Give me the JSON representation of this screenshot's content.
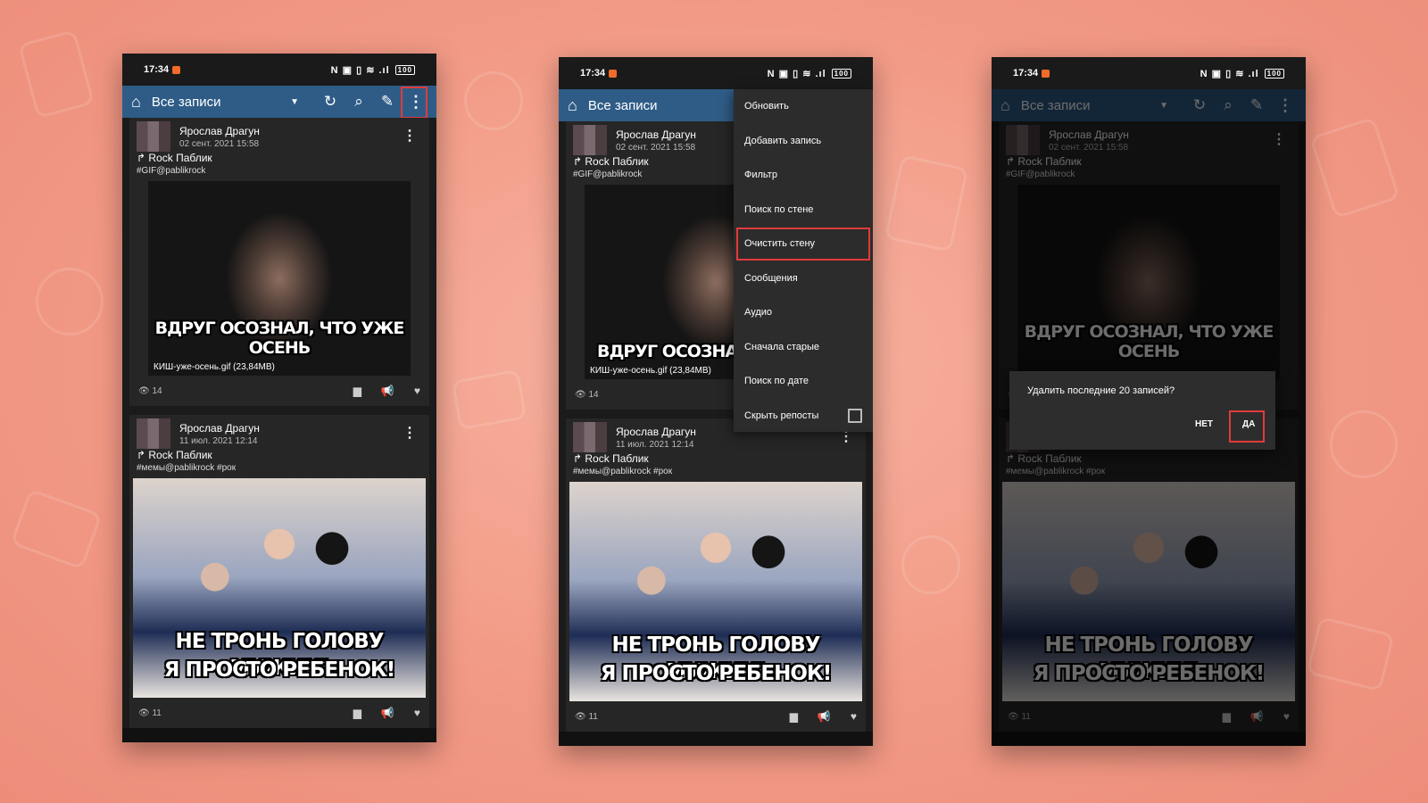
{
  "status": {
    "time": "17:34",
    "icons": "N ▣ ▯ ≋ .ıl",
    "battery": "100"
  },
  "toolbar": {
    "title": "Все записи",
    "home_icon": "home-icon",
    "dropdown_icon": "chevron-down-icon",
    "refresh_icon": "refresh-icon",
    "search_icon": "search-icon",
    "edit_icon": "pencil-icon",
    "more_icon": "more-vertical-icon"
  },
  "posts": [
    {
      "author": "Ярослав Драгун",
      "date": "02 сент. 2021 15:58",
      "repost_source": "Rock Паблик",
      "hashtags": "#GIF@pablikrock",
      "caption": "ВДРУГ ОСОЗНАЛ, ЧТО УЖЕ ОСЕНЬ",
      "caption_cut": "ВДРУГ ОСОЗНАЛ, Ч",
      "file": "КИШ-уже-осень.gif (23,84MB)",
      "views": "14"
    },
    {
      "author": "Ярослав Драгун",
      "date": "11 июл. 2021 12:14",
      "repost_source": "Rock Паблик",
      "hashtags": "#мемы@pablikrock #рок",
      "caption_line1": "НЕ ТРОНЬ ГОЛОВУ МУЖИК!",
      "caption_line2": "Я ПРОСТО РЕБЕНОК!",
      "views": "11"
    }
  ],
  "menu": {
    "items": [
      "Обновить",
      "Добавить запись",
      "Фильтр",
      "Поиск по стене",
      "Очистить стену",
      "Сообщения",
      "Аудио",
      "Сначала старые",
      "Поиск по дате",
      "Скрыть репосты"
    ],
    "highlighted": "Очистить стену"
  },
  "dialog": {
    "message": "Удалить последние 20 записей?",
    "no": "НЕТ",
    "yes": "ДА"
  },
  "colors": {
    "toolbar": "#2f5c87",
    "highlight": "#e23a3a",
    "background": "#f29a86"
  }
}
